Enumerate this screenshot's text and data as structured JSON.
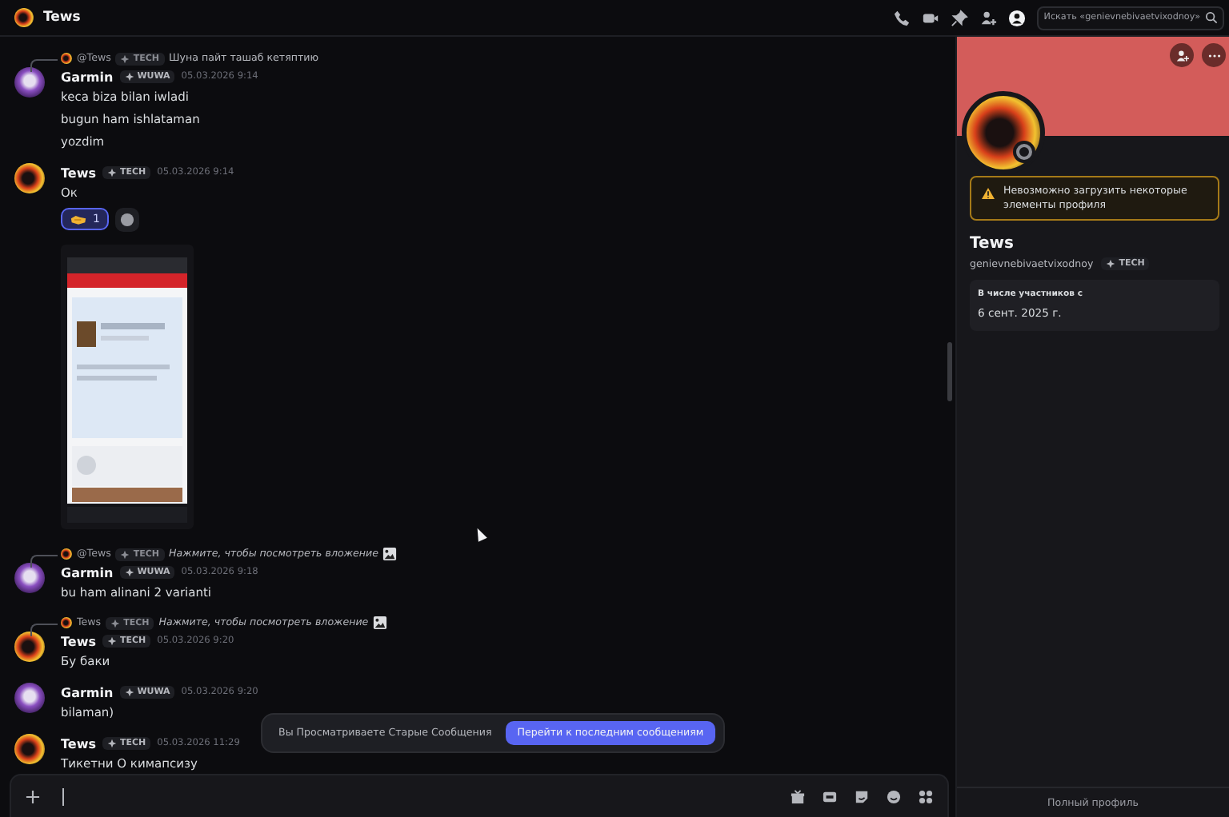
{
  "header": {
    "title": "Tews"
  },
  "search": {
    "placeholder": "Искать «genievnebivaetvixodnoy»"
  },
  "messages": [
    {
      "author": "Garmin",
      "avatar": {
        "kind": "purple"
      },
      "tag": "WUWA",
      "time": "05.03.2026 9:14",
      "reply": {
        "author": "@Tews",
        "tag": "TECH",
        "text": "Шуна пайт ташаб кетяптию",
        "attachment": false
      },
      "lines": [
        "keca biza bilan iwladi",
        "bugun ham ishlataman",
        "yozdim"
      ]
    },
    {
      "author": "Tews",
      "avatar": {
        "kind": "fire"
      },
      "tag": "TECH",
      "time": "05.03.2026 9:14",
      "lines": [
        "Ок"
      ],
      "reactions": [
        {
          "count": "1",
          "selected": true
        }
      ]
    },
    {
      "author": "Garmin",
      "avatar": {
        "kind": "purple"
      },
      "tag": "WUWA",
      "time": "05.03.2026 9:18",
      "reply": {
        "author": "@Tews",
        "tag": "TECH",
        "text": "Нажмите, чтобы посмотреть вложение",
        "attachment": true
      },
      "lines": [
        "bu ham alinani 2 varianti"
      ]
    },
    {
      "author": "Tews",
      "avatar": {
        "kind": "fire"
      },
      "tag": "TECH",
      "time": "05.03.2026 9:20",
      "reply": {
        "author": "Tews",
        "tag": "TECH",
        "text": "Нажмите, чтобы посмотреть вложение",
        "attachment": true
      },
      "lines": [
        "Бу баки"
      ]
    },
    {
      "author": "Garmin",
      "avatar": {
        "kind": "purple"
      },
      "tag": "WUWA",
      "time": "05.03.2026 9:20",
      "lines": [
        "bilaman)"
      ]
    },
    {
      "author": "Tews",
      "avatar": {
        "kind": "fire"
      },
      "tag": "TECH",
      "time": "05.03.2026 11:29",
      "lines": [
        "Тикетни О кимапсизу"
      ]
    }
  ],
  "notice": {
    "text": "Вы Просматриваете Старые Сообщения",
    "button": "Перейти к последним сообщениям"
  },
  "profile": {
    "warning": "Невозможно загрузить некоторые элементы профиля",
    "name": "Tews",
    "username": "genievnebivaetvixodnoy",
    "tag": "TECH",
    "member_since_label": "В числе участников с",
    "member_since": "6 сент. 2025 г.",
    "footer": "Полный профиль"
  }
}
